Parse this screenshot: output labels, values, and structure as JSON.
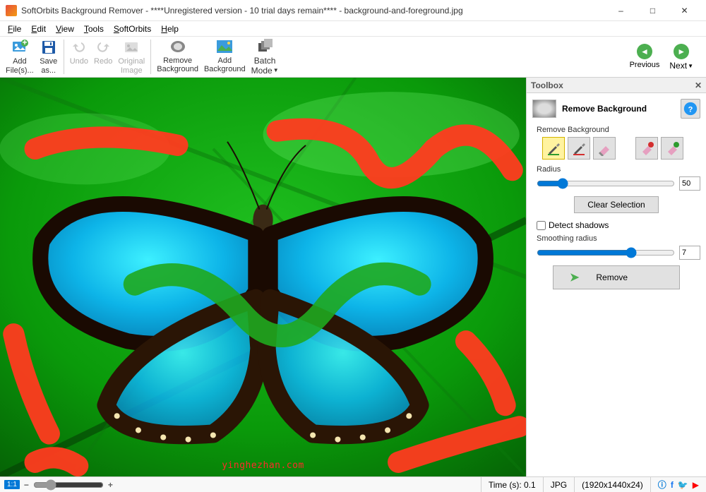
{
  "titlebar": {
    "title": "SoftOrbits Background Remover - ****Unregistered version - 10 trial days remain**** - background-and-foreground.jpg"
  },
  "menu": {
    "file": "File",
    "file_u": "F",
    "edit": "Edit",
    "edit_u": "E",
    "view": "View",
    "view_u": "V",
    "tools": "Tools",
    "tools_u": "T",
    "softorbits": "SoftOrbits",
    "softorbits_u": "S",
    "help": "Help",
    "help_u": "H"
  },
  "toolbar": {
    "add_files": "Add\nFile(s)...",
    "save_as": "Save\nas...",
    "undo": "Undo",
    "redo": "Redo",
    "original_image": "Original\nImage",
    "remove_bg": "Remove\nBackground",
    "add_bg": "Add\nBackground",
    "batch_mode": "Batch\nMode",
    "previous": "Previous",
    "next": "Next"
  },
  "toolbox": {
    "panel_title": "Toolbox",
    "section_title": "Remove Background",
    "group_label": "Remove Background",
    "radius_label": "Radius",
    "radius_value": "50",
    "clear_selection": "Clear Selection",
    "detect_shadows": "Detect shadows",
    "smoothing_label": "Smoothing radius",
    "smoothing_value": "7",
    "remove_btn": "Remove"
  },
  "statusbar": {
    "zoom_label": "1:1",
    "time_label": "Time (s): 0.1",
    "format": "JPG",
    "dimensions": "(1920x1440x24)"
  },
  "canvas": {
    "watermark": "yinghezhan.com"
  }
}
